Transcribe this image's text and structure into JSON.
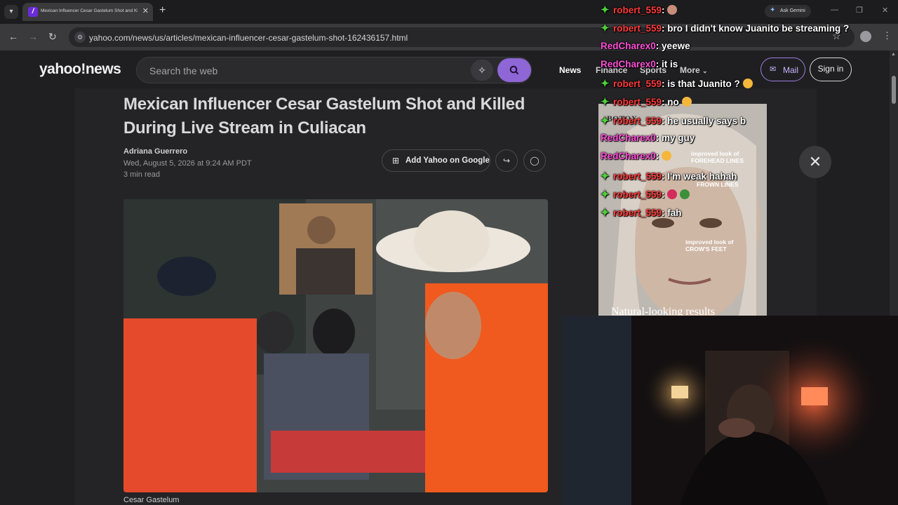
{
  "browser": {
    "tab_title": "Mexican Influencer Cesar Gastelum Shot and Killed Du",
    "tab_list_icon": "chevron-down",
    "new_tab_icon": "+",
    "gemini_label": "Ask Gemini",
    "url": "yahoo.com/news/us/articles/mexican-influencer-cesar-gastelum-shot-162436157.html",
    "window_controls": [
      "—",
      "❐",
      "✕"
    ]
  },
  "yahoo": {
    "logo": "yahoo!news",
    "search_placeholder": "Search the web",
    "nav": [
      "News",
      "Finance",
      "Sports",
      "More"
    ],
    "mail_label": "Mail",
    "signin_label": "Sign in",
    "brand_color": "#8e66d6"
  },
  "article": {
    "headline": "Mexican Influencer Cesar Gastelum Shot and Killed During Live Stream in Culiacan",
    "author": "Adriana Guerrero",
    "date": "Wed, August 5, 2026 at 9:24 AM PDT",
    "read_time": "3 min read",
    "add_google_label": "Add Yahoo on Google",
    "caption": "Cesar Gastelum"
  },
  "ad": {
    "brand": "BOTOX",
    "labels": [
      "improved look of FOREHEAD LINES",
      "FROWN LINES",
      "improved look of CROW'S FEET"
    ],
    "tagline": "Natural-looking results"
  },
  "chat": [
    {
      "user": "robert_559",
      "icon": "green-star",
      "message": "",
      "emote": "avatar"
    },
    {
      "user": "robert_559",
      "icon": "green-star",
      "message": "bro I didn't know Juanito be streaming ?"
    },
    {
      "user": "RedCharex0",
      "icon": "",
      "message": "yeewe"
    },
    {
      "user": "RedCharex0",
      "icon": "",
      "message": "it is"
    },
    {
      "user": "robert_559",
      "icon": "green-star",
      "message": "is that Juanito ?",
      "emote": "laugh"
    },
    {
      "user": "robert_559",
      "icon": "green-star",
      "message": "no",
      "emote": "laugh"
    },
    {
      "user": "robert_559",
      "icon": "green-star",
      "message": "he usually says b"
    },
    {
      "user": "RedCharex0",
      "icon": "",
      "message": "my guy"
    },
    {
      "user": "RedCharex0",
      "icon": "",
      "message": "",
      "emote": "shock"
    },
    {
      "user": "robert_559",
      "icon": "green-star",
      "message": "I'm weak hahah"
    },
    {
      "user": "robert_559",
      "icon": "green-star",
      "message": "",
      "emote": "heart-rose"
    },
    {
      "user": "robert_559",
      "icon": "green-star",
      "message": "fah"
    }
  ]
}
